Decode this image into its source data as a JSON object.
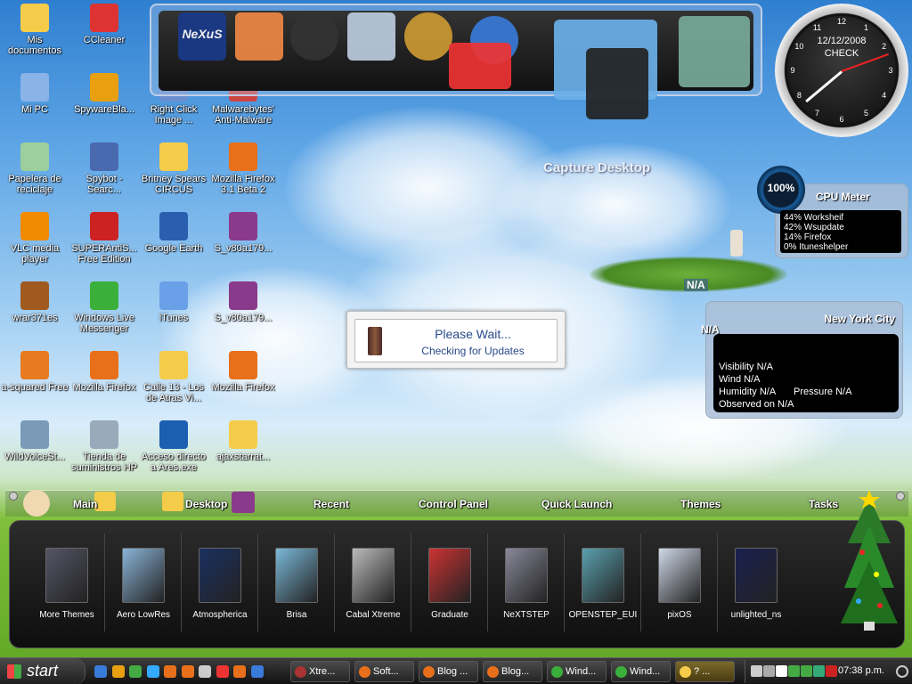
{
  "desktop": {
    "icons": [
      {
        "label": "Mis documentos",
        "icon": "my-documents-folder-icon",
        "color": "#f5cc4a"
      },
      {
        "label": "CCleaner",
        "icon": "ccleaner-icon",
        "color": "#d33"
      },
      {
        "label": "Mi PC",
        "icon": "my-computer-icon",
        "color": "#8ab4e8"
      },
      {
        "label": "SpywareBla...",
        "icon": "spywareblaster-icon",
        "color": "#e8a010"
      },
      {
        "label": "Right Click Image ...",
        "icon": "right-click-image-icon",
        "color": "#6a8fd0"
      },
      {
        "label": "Malwarebytes' Anti-Malware",
        "icon": "malwarebytes-icon",
        "color": "#c44"
      },
      {
        "label": "Papelera de reciclaje",
        "icon": "recycle-bin-icon",
        "color": "#9ccf9c"
      },
      {
        "label": "Spybot - Searc...",
        "icon": "spybot-icon",
        "color": "#4a6ab0"
      },
      {
        "label": "Britney Spears CIRCUS",
        "icon": "folder-icon",
        "color": "#f5cc4a"
      },
      {
        "label": "Mozilla Firefox 3.1 Beta 2",
        "icon": "firefox-icon",
        "color": "#e8701a"
      },
      {
        "label": "VLC media player",
        "icon": "vlc-icon",
        "color": "#f08a00"
      },
      {
        "label": "SUPERAntiS... Free Edition",
        "icon": "superantispyware-icon",
        "color": "#c22"
      },
      {
        "label": "Google Earth",
        "icon": "google-earth-icon",
        "color": "#2a5fb0"
      },
      {
        "label": "S_v80a179...",
        "icon": "winrar-archive-icon",
        "color": "#8a3a8a"
      },
      {
        "label": "wrar371es",
        "icon": "winrar-installer-icon",
        "color": "#a05a20"
      },
      {
        "label": "Windows Live Messenger",
        "icon": "messenger-icon",
        "color": "#3ab03a"
      },
      {
        "label": "iTunes",
        "icon": "itunes-icon",
        "color": "#6aa0e8"
      },
      {
        "label": "S_v80a179...",
        "icon": "winrar-archive-icon",
        "color": "#8a3a8a"
      },
      {
        "label": "a-squared Free",
        "icon": "a-squared-icon",
        "color": "#e87a20"
      },
      {
        "label": "Mozilla Firefox",
        "icon": "firefox-icon",
        "color": "#e8701a"
      },
      {
        "label": "Calle 13 - Los de Atras Vi...",
        "icon": "folder-icon",
        "color": "#f5cc4a"
      },
      {
        "label": "Mozilla Firefox",
        "icon": "firefox-icon",
        "color": "#e8701a"
      },
      {
        "label": "WildVoiceSt...",
        "icon": "wildvoice-icon",
        "color": "#7a9ab8"
      },
      {
        "label": "Tienda de suministros HP",
        "icon": "hp-printer-icon",
        "color": "#9ab"
      },
      {
        "label": "Acceso directo a Ares.exe",
        "icon": "ares-icon",
        "color": "#1a5fb0"
      },
      {
        "label": "ajaxstarrat...",
        "icon": "folder-icon",
        "color": "#f5cc4a"
      }
    ],
    "wallpaper_caption": "Capture Desktop",
    "island_label": "N/A"
  },
  "dock": {
    "items": [
      {
        "name": "nexus-logo-icon",
        "label": "NeXuS",
        "color": "#1a3a8a"
      },
      {
        "name": "windows-logo-icon",
        "color": "#e84"
      },
      {
        "name": "clock-app-icon",
        "color": "#333"
      },
      {
        "name": "recycle-bin-icon",
        "color": "#bcd"
      },
      {
        "name": "network-globe-icon",
        "color": "#c93"
      },
      {
        "name": "internet-globe-icon",
        "color": "#3a7ad8"
      },
      {
        "name": "email-icon",
        "color": "#e33"
      },
      {
        "name": "photo-viewer-icon",
        "color": "#6ab0e8"
      },
      {
        "name": "camera-icon",
        "color": "#222"
      },
      {
        "name": "system-clock-icon",
        "color": "#7a9"
      }
    ]
  },
  "clock": {
    "date": "12/12/2008",
    "label": "CHECK",
    "numbers": [
      "12",
      "1",
      "2",
      "3",
      "4",
      "5",
      "6",
      "7",
      "8",
      "9",
      "10",
      "11"
    ]
  },
  "cpu_meter": {
    "title": "CPU Meter",
    "percent": "100%",
    "processes": [
      "44% Worksheif",
      "42% Wsupdate",
      "14% Firefox",
      "0% Ituneshelper"
    ]
  },
  "weather": {
    "city": "New York City",
    "temp": "N/A",
    "visibility": "Visibility N/A",
    "wind": "Wind N/A",
    "humidity": "Humidity N/A",
    "pressure": "Pressure N/A",
    "observed": "Observed on N/A"
  },
  "dialog": {
    "title": "Please Wait...",
    "message": "Checking for Updates"
  },
  "launcher": {
    "tabs": [
      "Main",
      "Desktop",
      "Recent",
      "Control Panel",
      "Quick Launch",
      "Themes",
      "Tasks"
    ],
    "themes": [
      {
        "label": "More Themes",
        "color": "#556"
      },
      {
        "label": "Aero LowRes",
        "color": "#8ab4d8"
      },
      {
        "label": "Atmospherica",
        "color": "#1a3060"
      },
      {
        "label": "Brisa",
        "color": "#7ab8d8"
      },
      {
        "label": "Cabal Xtreme",
        "color": "#bbb"
      },
      {
        "label": "Graduate",
        "color": "#c33"
      },
      {
        "label": "NeXTSTEP",
        "color": "#889"
      },
      {
        "label": "OPENSTEP_EUI",
        "color": "#5aa0b0"
      },
      {
        "label": "pixOS",
        "color": "#cfd8e8"
      },
      {
        "label": "unlighted_ns",
        "color": "#1a2050"
      }
    ]
  },
  "taskbar": {
    "start_label": "start",
    "tasks": [
      {
        "label": "Xtre...",
        "color": "#a33"
      },
      {
        "label": "Soft...",
        "color": "#e8701a"
      },
      {
        "label": "Blog ...",
        "color": "#e8701a"
      },
      {
        "label": "Blog...",
        "color": "#e8701a"
      },
      {
        "label": "Wind...",
        "color": "#3ab03a"
      },
      {
        "label": "Wind...",
        "color": "#3ab03a"
      },
      {
        "label": "? ...",
        "color": "#f5cc4a"
      }
    ],
    "time": "07:38 p.m."
  }
}
